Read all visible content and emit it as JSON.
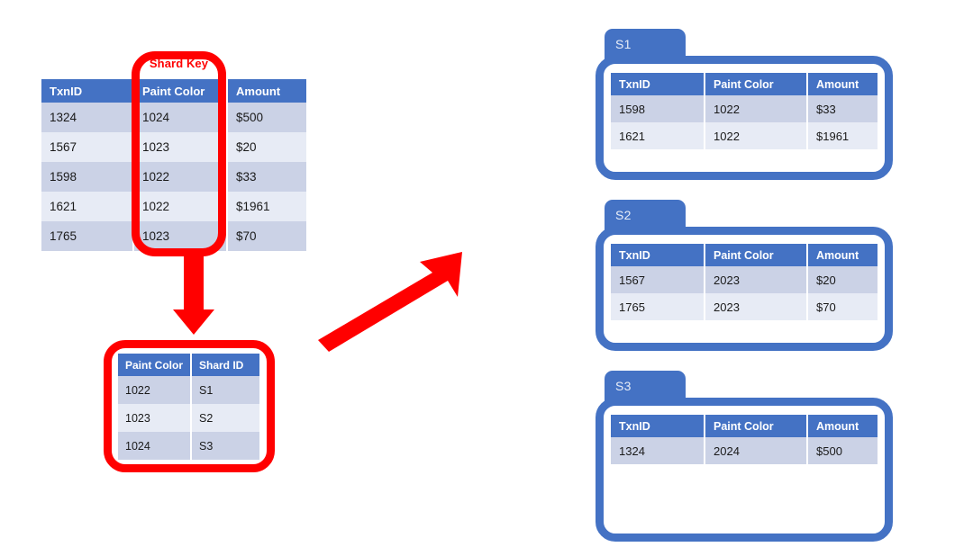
{
  "diagram": {
    "title": "Database sharding by shard key",
    "accent_blue": "#4472C4",
    "accent_red": "#FF0000",
    "row_dark": "#CBD2E6",
    "row_light": "#E7EBF5"
  },
  "shard_key_caption": "Shard Key",
  "source_table": {
    "name": "transactions-table",
    "columns": [
      "TxnID",
      "Paint Color",
      "Amount"
    ],
    "rows": [
      [
        "1324",
        "1024",
        "$500"
      ],
      [
        "1567",
        "1023",
        "$20"
      ],
      [
        "1598",
        "1022",
        "$33"
      ],
      [
        "1621",
        "1022",
        "$1961"
      ],
      [
        "1765",
        "1023",
        "$70"
      ]
    ]
  },
  "lookup_table": {
    "name": "shard-lookup-table",
    "columns": [
      "Paint Color",
      "Shard ID"
    ],
    "rows": [
      [
        "1022",
        "S1"
      ],
      [
        "1023",
        "S2"
      ],
      [
        "1024",
        "S3"
      ]
    ]
  },
  "shards": [
    {
      "label": "S1",
      "columns": [
        "TxnID",
        "Paint Color",
        "Amount"
      ],
      "rows": [
        [
          "1598",
          "1022",
          "$33"
        ],
        [
          "1621",
          "1022",
          "$1961"
        ]
      ]
    },
    {
      "label": "S2",
      "columns": [
        "TxnID",
        "Paint Color",
        "Amount"
      ],
      "rows": [
        [
          "1567",
          "2023",
          "$20"
        ],
        [
          "1765",
          "2023",
          "$70"
        ]
      ]
    },
    {
      "label": "S3",
      "columns": [
        "TxnID",
        "Paint Color",
        "Amount"
      ],
      "rows": [
        [
          "1324",
          "2024",
          "$500"
        ]
      ]
    }
  ],
  "arrows": [
    {
      "name": "down-arrow",
      "from": "source-table-shard-key",
      "to": "lookup-table",
      "color": "#FF0000"
    },
    {
      "name": "diagonal-arrow",
      "from": "lookup-table",
      "to": "shard-folders",
      "color": "#FF0000"
    }
  ]
}
